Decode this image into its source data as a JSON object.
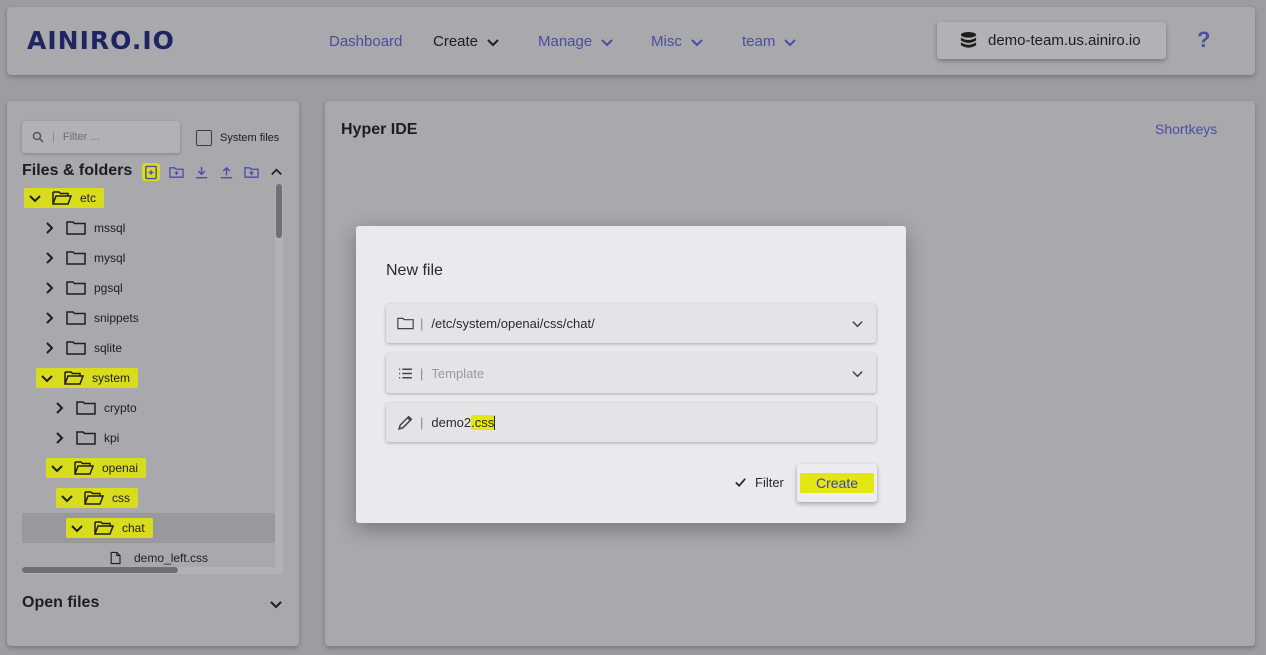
{
  "header": {
    "logo_text": "AINIRO.IO",
    "nav": [
      {
        "label": "Dashboard",
        "dropdown": false
      },
      {
        "label": "Create",
        "dropdown": true
      },
      {
        "label": "Manage",
        "dropdown": true
      },
      {
        "label": "Misc",
        "dropdown": true
      },
      {
        "label": "team",
        "dropdown": true
      }
    ],
    "server": "demo-team.us.ainiro.io",
    "help": "?"
  },
  "sidebar": {
    "filter_placeholder": "Filter ...",
    "system_files_label": "System files",
    "title": "Files & folders",
    "tree": [
      {
        "label": "etc"
      },
      {
        "label": "mssql"
      },
      {
        "label": "mysql"
      },
      {
        "label": "pgsql"
      },
      {
        "label": "snippets"
      },
      {
        "label": "sqlite"
      },
      {
        "label": "system"
      },
      {
        "label": "crypto"
      },
      {
        "label": "kpi"
      },
      {
        "label": "openai"
      },
      {
        "label": "css"
      },
      {
        "label": "chat"
      },
      {
        "label": "demo_left.css"
      }
    ],
    "open_files_title": "Open files"
  },
  "main": {
    "title": "Hyper IDE",
    "shortkeys": "Shortkeys"
  },
  "modal": {
    "title": "New file",
    "folder_value": "/etc/system/openai/css/chat/",
    "template_placeholder": "Template",
    "filename_prefix": "demo2",
    "filename_ext": ".css",
    "filter_label": "Filter",
    "create_label": "Create"
  },
  "colors": {
    "accent": "#4a4fa0",
    "highlight": "#d8dc1c"
  }
}
